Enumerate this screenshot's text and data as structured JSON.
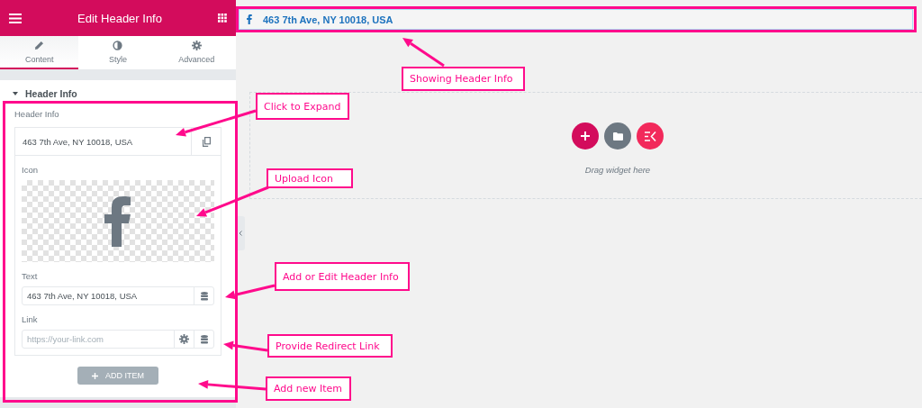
{
  "panel": {
    "title": "Edit Header Info",
    "tabs": [
      {
        "label": "Content",
        "selected": true,
        "kind": "pencil"
      },
      {
        "label": "Style",
        "selected": false,
        "kind": "contrast"
      },
      {
        "label": "Advanced",
        "selected": false,
        "kind": "gear"
      }
    ],
    "section": {
      "title": "Header Info",
      "expanded": true
    },
    "repeater": {
      "label": "Header Info",
      "items": [
        {
          "title": "463 7th Ave, NY 10018, USA",
          "expanded": true,
          "icon_label": "Icon",
          "text_label": "Text",
          "text_value": "463 7th Ave, NY 10018, USA",
          "link_label": "Link",
          "link_placeholder": "https://your-link.com"
        }
      ]
    },
    "add_button": {
      "label": "ADD ITEM",
      "disabled": true
    }
  },
  "preview": {
    "text": "463 7th Ave, NY 10018, USA"
  },
  "drop_zone": {
    "hint": "Drag widget here"
  },
  "annotations": [
    {
      "label": "Showing Header Info"
    },
    {
      "label": "Click to Expand"
    },
    {
      "label": "Upload Icon"
    },
    {
      "label": "Add or Edit Header Info"
    },
    {
      "label": "Provide Redirect Link"
    },
    {
      "label": "Add new Item"
    }
  ]
}
